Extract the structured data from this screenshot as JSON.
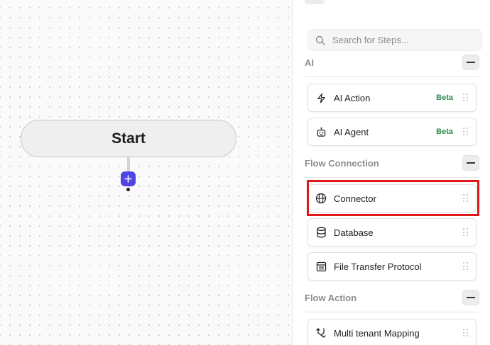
{
  "canvas": {
    "start_node_label": "Start"
  },
  "panel": {
    "search": {
      "placeholder": "Search for Steps..."
    },
    "sections": [
      {
        "title": "AI",
        "steps": [
          {
            "label": "AI Action",
            "badge": "Beta",
            "icon": "lightning-icon"
          },
          {
            "label": "AI Agent",
            "badge": "Beta",
            "icon": "robot-icon"
          }
        ]
      },
      {
        "title": "Flow Connection",
        "steps": [
          {
            "label": "Connector",
            "icon": "globe-icon"
          },
          {
            "label": "Database",
            "icon": "database-icon"
          },
          {
            "label": "File Transfer Protocol",
            "icon": "file-transfer-icon"
          }
        ]
      },
      {
        "title": "Flow Action",
        "steps": [
          {
            "label": "Multi tenant Mapping",
            "icon": "mapping-icon"
          }
        ]
      }
    ]
  },
  "colors": {
    "accent": "#4f46e5",
    "badge": "#2f8a4f",
    "highlight": "#e0161b"
  }
}
